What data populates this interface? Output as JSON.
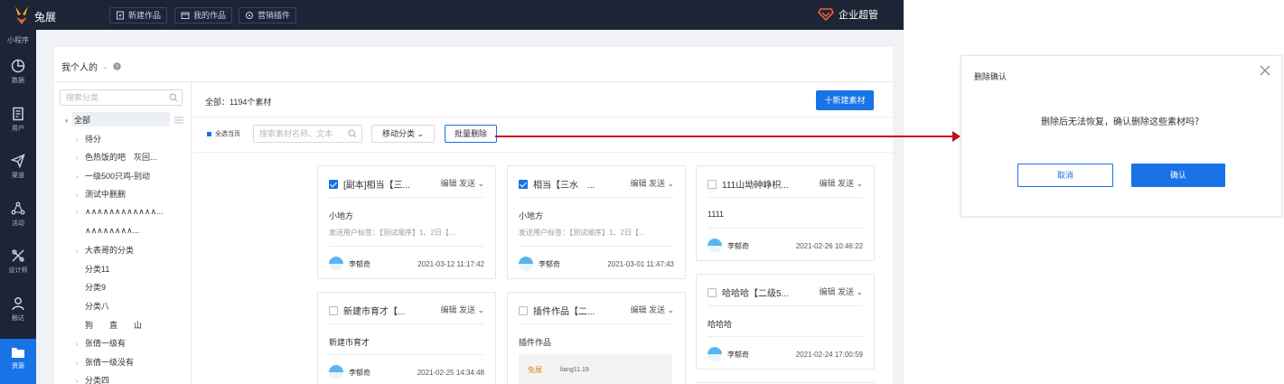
{
  "brand": {
    "name": "兔展"
  },
  "topbar": {
    "buttons": [
      {
        "label": "新建作品",
        "icon": "new-doc-icon"
      },
      {
        "label": "我的作品",
        "icon": "folder-icon"
      },
      {
        "label": "营销插件",
        "icon": "plugin-icon"
      }
    ],
    "enterprise": "企业超管"
  },
  "sidenav": {
    "mini_label": "小程序",
    "items": [
      {
        "label": "数据",
        "icon": "pie-chart-icon"
      },
      {
        "label": "用户",
        "icon": "users-icon"
      },
      {
        "label": "渠道",
        "icon": "send-icon"
      },
      {
        "label": "活动",
        "icon": "activity-icon"
      },
      {
        "label": "设计师",
        "icon": "design-icon"
      },
      {
        "label": "触达",
        "icon": "user-reach-icon"
      },
      {
        "label": "资源",
        "icon": "folder-resource-icon",
        "active": true
      }
    ]
  },
  "header": {
    "title": "我个人的"
  },
  "tree": {
    "search_placeholder": "搜索分类",
    "nodes": [
      {
        "label": "全部",
        "level": 0,
        "arrow": "▾",
        "selected": true
      },
      {
        "label": "待分",
        "level": 1,
        "arrow": "›"
      },
      {
        "label": "色热饭的吧　灰回...",
        "level": 1,
        "arrow": "›"
      },
      {
        "label": "一级500只鸡-别动",
        "level": 1,
        "arrow": "›"
      },
      {
        "label": "测试中删删",
        "level": 1,
        "arrow": "›"
      },
      {
        "label": "∧∧∧∧∧∧∧∧∧∧∧∧...",
        "level": 1,
        "arrow": "›"
      },
      {
        "label": "∧∧∧∧∧∧∧∧...",
        "level": 1,
        "arrow": ""
      },
      {
        "label": "大表哥的分类",
        "level": 1,
        "arrow": "›"
      },
      {
        "label": "分类11",
        "level": 1,
        "arrow": ""
      },
      {
        "label": "分类9",
        "level": 1,
        "arrow": ""
      },
      {
        "label": "分类八",
        "level": 1,
        "arrow": ""
      },
      {
        "label": "狗　　直　　山",
        "level": 1,
        "arrow": ""
      },
      {
        "label": "张倩一级有",
        "level": 1,
        "arrow": "›"
      },
      {
        "label": "张倩一级没有",
        "level": 1,
        "arrow": "›"
      },
      {
        "label": "分类四",
        "level": 1,
        "arrow": "›"
      }
    ]
  },
  "main": {
    "total": "全部：1194个素材",
    "new_button": "十新建素材",
    "select_page": "全选当页",
    "search_placeholder": "搜索素材名称、文本",
    "move_button": "移动分类 ⌄",
    "bulk_delete": "批量删除",
    "card_actions": "编辑 发送 ⌄",
    "cards": [
      {
        "title": "[副本]相当【三...",
        "checked": true,
        "line1": "小地方",
        "line2": "发送用户标签：【测试顺序】1、2日【...",
        "user": "李郁奇",
        "date": "2021-03-12 11:17:42"
      },
      {
        "title": "相当【三水　...",
        "checked": true,
        "line1": "小地方",
        "line2": "发送用户标签：【测试顺序】1、2日【...",
        "user": "李郁奇",
        "date": "2021-03-01 11:47:43"
      },
      {
        "title": "111山坳砷峥枳...",
        "checked": false,
        "line1": "1111",
        "line2": "",
        "user": "李郁奇",
        "date": "2021-02-26 10:46:22"
      },
      {
        "title": "哈哈哈【二级5...",
        "checked": false,
        "line1": "哈哈哈",
        "line2": "",
        "user": "李郁奇",
        "date": "2021-02-24 17:00:59"
      },
      {
        "title": "新建市育才【...",
        "checked": false,
        "line1": "新建市育才",
        "line2": "",
        "user": "李郁奇",
        "date": "2021-02-25 14:34:48"
      },
      {
        "title": "插件作品【二...",
        "checked": false,
        "line1": "插件作品",
        "line2": "",
        "thumb_logo": "兔展",
        "thumb_text": "liang11.19"
      }
    ]
  },
  "dialog": {
    "title": "删除确认",
    "message": "删除后无法恢复，确认删除这些素材吗？",
    "cancel": "取消",
    "confirm": "确认"
  },
  "colors": {
    "accent": "#1773e6",
    "nav_bg": "#1c2436",
    "annotation": "#c40d1e",
    "enterprise_icon": "#f0642b"
  }
}
